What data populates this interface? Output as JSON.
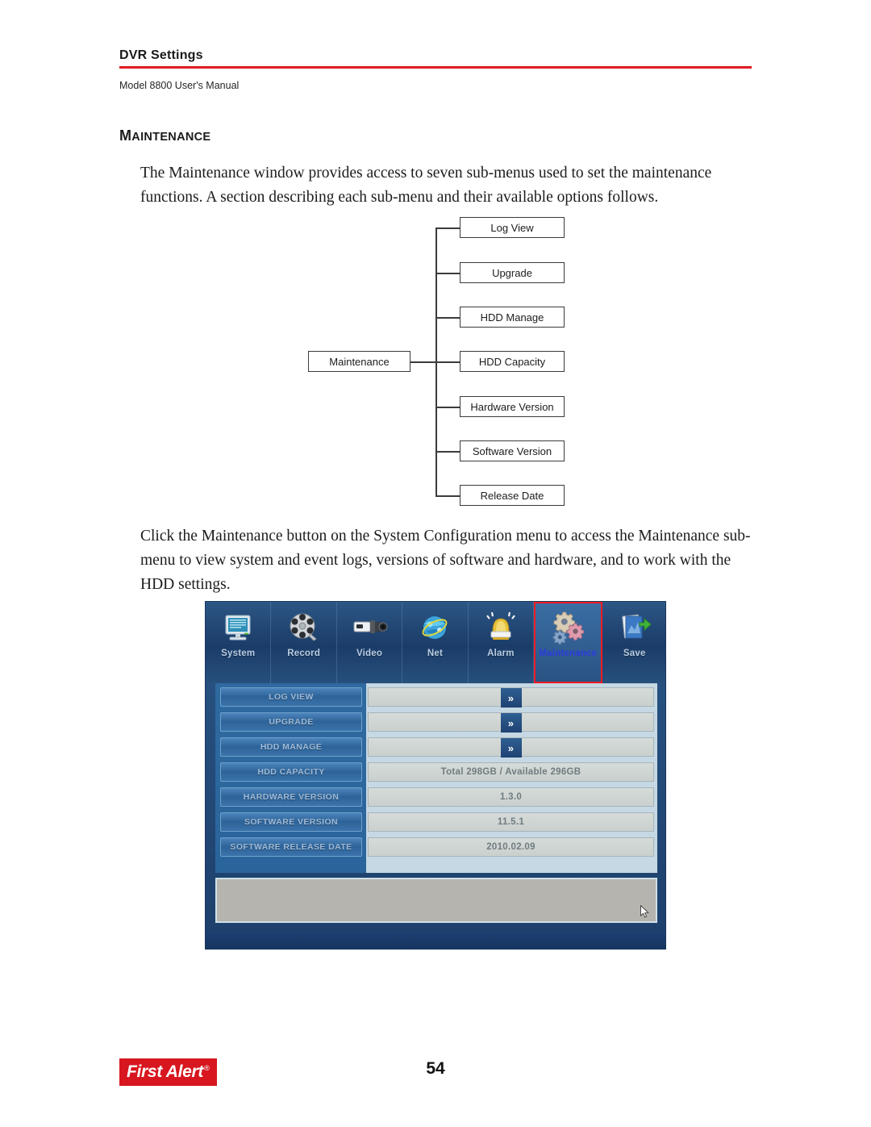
{
  "header": {
    "title": "DVR Settings",
    "subtitle": "Model 8800 User's Manual",
    "rule_color": "#e01b22"
  },
  "section": {
    "heading_first_letter": "M",
    "heading_rest": "AINTENANCE",
    "intro_paragraph": "The Maintenance window provides access to seven sub-menus used to set the maintenance functions. A section describing each sub-menu and their available options follows.",
    "access_paragraph": "Click the Maintenance button on the System Configuration menu to access the Maintenance sub-menu to view system and event logs, versions of software and hardware, and to work with the HDD settings."
  },
  "tree_diagram": {
    "root_label": "Maintenance",
    "children": [
      {
        "label": "Log View"
      },
      {
        "label": "Upgrade"
      },
      {
        "label": "HDD Manage"
      },
      {
        "label": "HDD Capacity"
      },
      {
        "label": "Hardware Version"
      },
      {
        "label": "Software Version"
      },
      {
        "label": "Release Date"
      }
    ]
  },
  "dvr_screenshot": {
    "toolbar": [
      {
        "label": "System",
        "icon": "monitor-icon",
        "active": false
      },
      {
        "label": "Record",
        "icon": "film-reel-icon",
        "active": false
      },
      {
        "label": "Video",
        "icon": "camera-icon",
        "active": false
      },
      {
        "label": "Net",
        "icon": "globe-network-icon",
        "active": false
      },
      {
        "label": "Alarm",
        "icon": "siren-icon",
        "active": false
      },
      {
        "label": "Maintenance",
        "icon": "gears-icon",
        "active": true
      },
      {
        "label": "Save",
        "icon": "save-documents-icon",
        "active": false
      }
    ],
    "highlight_color": "#ee1c23",
    "active_label_color": "#2b3ddc",
    "menu_buttons": [
      {
        "label": "LOG VIEW"
      },
      {
        "label": "UPGRADE"
      },
      {
        "label": "HDD MANAGE"
      },
      {
        "label": "HDD CAPACITY"
      },
      {
        "label": "HARDWARE VERSION"
      },
      {
        "label": "SOFTWARE VERSION"
      },
      {
        "label": "SOFTWARE RELEASE DATE"
      }
    ],
    "value_rows": [
      {
        "value": "",
        "has_arrow": true,
        "arrow_glyph": "»"
      },
      {
        "value": "",
        "has_arrow": true,
        "arrow_glyph": "»"
      },
      {
        "value": "",
        "has_arrow": true,
        "arrow_glyph": "»"
      },
      {
        "value": "Total 298GB / Available 296GB",
        "has_arrow": false
      },
      {
        "value": "1.3.0",
        "has_arrow": false
      },
      {
        "value": "11.5.1",
        "has_arrow": false
      },
      {
        "value": "2010.02.09",
        "has_arrow": false
      }
    ],
    "status_panel_text": ""
  },
  "footer": {
    "brand_name": "First Alert",
    "brand_mark": "®",
    "brand_color": "#d8161f",
    "page_number": "54"
  }
}
